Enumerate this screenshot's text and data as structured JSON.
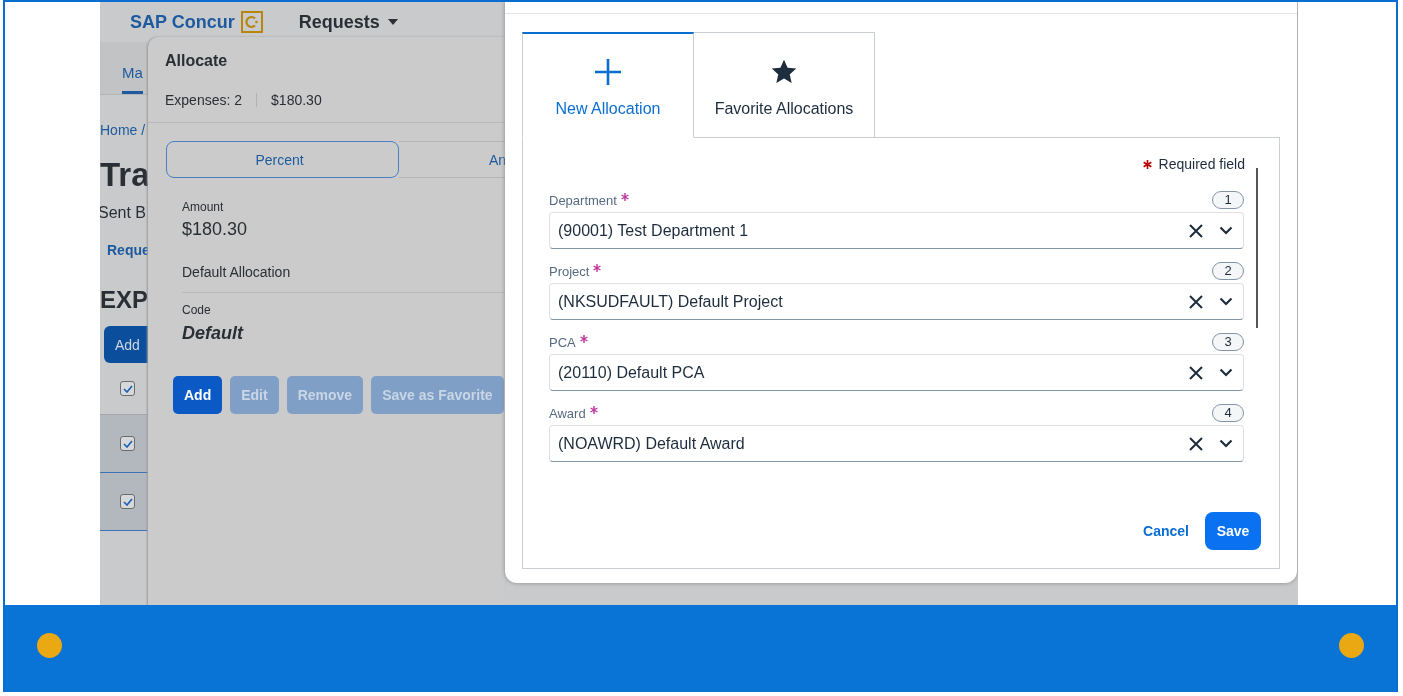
{
  "background_page": {
    "logo": "SAP Concur",
    "menu": "Requests",
    "tab": {
      "label": "Ma",
      "selected": true
    },
    "breadcrumb": "Home /",
    "title": "Tra",
    "subtitle": "Sent B",
    "link": "Reque",
    "section": "EXP",
    "add_button": "Add",
    "rows": [
      {
        "checked": true,
        "selected": false
      },
      {
        "checked": true,
        "selected": true
      },
      {
        "checked": true,
        "selected": true
      }
    ]
  },
  "allocate_panel": {
    "title": "Allocate",
    "expenses": "Expenses: 2",
    "total": "$180.30",
    "modes": [
      {
        "label": "Percent",
        "selected": true
      },
      {
        "label": "An",
        "selected": false
      }
    ],
    "amount_label": "Amount",
    "amount": "$180.30",
    "allocation_name": "Default Allocation",
    "code_label": "Code",
    "code": "Default",
    "buttons": [
      {
        "label": "Add",
        "disabled": false
      },
      {
        "label": "Edit",
        "disabled": true
      },
      {
        "label": "Remove",
        "disabled": true
      },
      {
        "label": "Save as Favorite",
        "disabled": true
      }
    ]
  },
  "dialog": {
    "tabs": [
      {
        "label": "New Allocation",
        "kind": "plus",
        "selected": true
      },
      {
        "label": "Favorite Allocations",
        "kind": "star",
        "selected": false
      }
    ],
    "required_note": "Required field",
    "fields": [
      {
        "label": "Department",
        "required": true,
        "number": "1",
        "value": "(90001) Test Department 1"
      },
      {
        "label": "Project",
        "required": true,
        "number": "2",
        "value": "(NKSUDFAULT) Default Project"
      },
      {
        "label": "PCA",
        "required": true,
        "number": "3",
        "value": "(20110) Default PCA"
      },
      {
        "label": "Award",
        "required": true,
        "number": "4",
        "value": "(NOAWRD) Default Award"
      }
    ],
    "cancel": "Cancel",
    "save": "Save"
  }
}
